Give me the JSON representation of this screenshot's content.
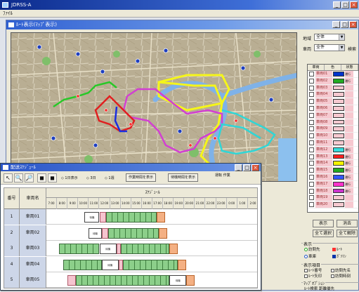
{
  "app": {
    "title": "JDRSS-A",
    "menu": "ﾌｧｲﾙ"
  },
  "mdi": {
    "title": "ﾙｰﾄ表示(ﾏｯﾌﾟ表示)"
  },
  "side": {
    "field1_label": "地域",
    "field1_value": "全体",
    "field2_label": "車両",
    "field2_value": "全件",
    "link": "検索",
    "list_headers": [
      "車両",
      "色",
      "状態"
    ],
    "vehicles": [
      {
        "name": "車両01",
        "color": "#0033cc",
        "tag": "運行"
      },
      {
        "name": "車両02",
        "color": "#22aa22",
        "tag": "運行"
      },
      {
        "name": "車両03",
        "color": "",
        "tag": ""
      },
      {
        "name": "車両04",
        "color": "",
        "tag": ""
      },
      {
        "name": "車両05",
        "color": "",
        "tag": ""
      },
      {
        "name": "車両06",
        "color": "",
        "tag": ""
      },
      {
        "name": "車両07",
        "color": "",
        "tag": ""
      },
      {
        "name": "車両08",
        "color": "",
        "tag": ""
      },
      {
        "name": "車両09",
        "color": "",
        "tag": ""
      },
      {
        "name": "車両10",
        "color": "",
        "tag": ""
      },
      {
        "name": "車両11",
        "color": "",
        "tag": ""
      },
      {
        "name": "車両12",
        "color": "#33dddd",
        "tag": "運行"
      },
      {
        "name": "車両13",
        "color": "#ff2020",
        "tag": "運行"
      },
      {
        "name": "車両14",
        "color": "#f2f200",
        "tag": "運行"
      },
      {
        "name": "車両15",
        "color": "#22aa22",
        "tag": "運行"
      },
      {
        "name": "車両16",
        "color": "#3355ff",
        "tag": "運行"
      },
      {
        "name": "車両17",
        "color": "#ff33cc",
        "tag": "運行"
      },
      {
        "name": "車両18",
        "color": "#cc33cc",
        "tag": "運行"
      },
      {
        "name": "車両19",
        "color": "",
        "tag": ""
      },
      {
        "name": "車両20",
        "color": "",
        "tag": ""
      }
    ],
    "buttons": [
      "表示",
      "消去",
      "全て選択",
      "全て解除"
    ],
    "group_display": "表示",
    "legend": [
      {
        "label": "訪問先",
        "color": "#22aa22",
        "kind": "radio"
      },
      {
        "label": "ﾙｰﾄ",
        "color": "#ff3030",
        "kind": "sq"
      },
      {
        "label": "車庫",
        "color": "#2255cc",
        "kind": "radio"
      },
      {
        "label": "ｶﾞｿﾘﾝ",
        "color": "#0033aa",
        "kind": "sq"
      }
    ],
    "group_options": "表示項目",
    "options": [
      "ﾙｰﾄ番号",
      "訪問先名",
      "ﾙｰﾄ矢印",
      "訪問時刻",
      "ｽｹｼﾞｭｰﾙ"
    ],
    "group_misc": "ﾏｯﾌﾟｵﾌﾟｼｮﾝ",
    "misc": [
      "ﾙｰﾄ検索 距離優先",
      "距離優先 時間優先 有料優先",
      "一般道優先 高速優先"
    ]
  },
  "gantt": {
    "title": "配送ｽｹｼﾞｭｰﾙ",
    "tools": [
      "↖",
      "🔍",
      "🔎",
      "◼",
      "◼"
    ],
    "tool_text1": "◇ 1日表示",
    "tool_text2": "◇ 3日",
    "tool_text3": "◇ 1週",
    "btn1": "作業時間を表示",
    "btn2": "待機時間を表示",
    "side_note": "運転 作業",
    "col_id": "番号",
    "col_name": "車両名",
    "span_label": "ｽｹｼﾞｭｰﾙ",
    "ticks": [
      "7:00",
      "8:00",
      "9:00",
      "10:00",
      "11:00",
      "12:00",
      "13:00",
      "14:00",
      "15:00",
      "16:00",
      "17:00",
      "18:00",
      "19:00",
      "20:00",
      "21:00",
      "22:00",
      "23:00",
      "0:00",
      "1:00",
      "2:00"
    ],
    "rows": [
      {
        "id": "1",
        "name": "車両01",
        "segments": [
          {
            "type": "white",
            "start": 0.18,
            "end": 0.25,
            "label": "待機"
          },
          {
            "type": "pink",
            "start": 0.25,
            "end": 0.28
          },
          {
            "type": "green",
            "start": 0.28,
            "end": 0.52
          },
          {
            "type": "orange",
            "start": 0.52,
            "end": 0.56
          }
        ]
      },
      {
        "id": "2",
        "name": "車両02",
        "segments": [
          {
            "type": "white",
            "start": 0.2,
            "end": 0.26,
            "label": "待機"
          },
          {
            "type": "pink",
            "start": 0.26,
            "end": 0.29
          },
          {
            "type": "green",
            "start": 0.29,
            "end": 0.53
          },
          {
            "type": "orange",
            "start": 0.53,
            "end": 0.57
          }
        ]
      },
      {
        "id": "3",
        "name": "車両03",
        "segments": [
          {
            "type": "green",
            "start": 0.06,
            "end": 0.25
          },
          {
            "type": "white",
            "start": 0.25,
            "end": 0.33,
            "label": "待機"
          },
          {
            "type": "pink",
            "start": 0.33,
            "end": 0.35
          },
          {
            "type": "green",
            "start": 0.35,
            "end": 0.58
          },
          {
            "type": "orange",
            "start": 0.58,
            "end": 0.62
          }
        ]
      },
      {
        "id": "4",
        "name": "車両04",
        "segments": [
          {
            "type": "green",
            "start": 0.08,
            "end": 0.26
          },
          {
            "type": "white",
            "start": 0.26,
            "end": 0.34,
            "label": "待機"
          },
          {
            "type": "pink",
            "start": 0.34,
            "end": 0.36
          },
          {
            "type": "green",
            "start": 0.36,
            "end": 0.62
          },
          {
            "type": "orange",
            "start": 0.62,
            "end": 0.66
          }
        ]
      },
      {
        "id": "5",
        "name": "車両05",
        "segments": [
          {
            "type": "pink",
            "start": 0.1,
            "end": 0.14
          },
          {
            "type": "green",
            "start": 0.14,
            "end": 0.58
          },
          {
            "type": "white",
            "start": 0.58,
            "end": 0.66,
            "label": "待機"
          },
          {
            "type": "orange",
            "start": 0.66,
            "end": 0.7
          }
        ]
      }
    ]
  },
  "colors": {
    "route_yellow": "#f5f51a",
    "route_magenta": "#d23fd2",
    "route_cyan": "#2fd6d6",
    "route_red": "#e02020",
    "route_green": "#28c828",
    "route_blue": "#1a2ee0",
    "river": "#7fb2e8"
  }
}
